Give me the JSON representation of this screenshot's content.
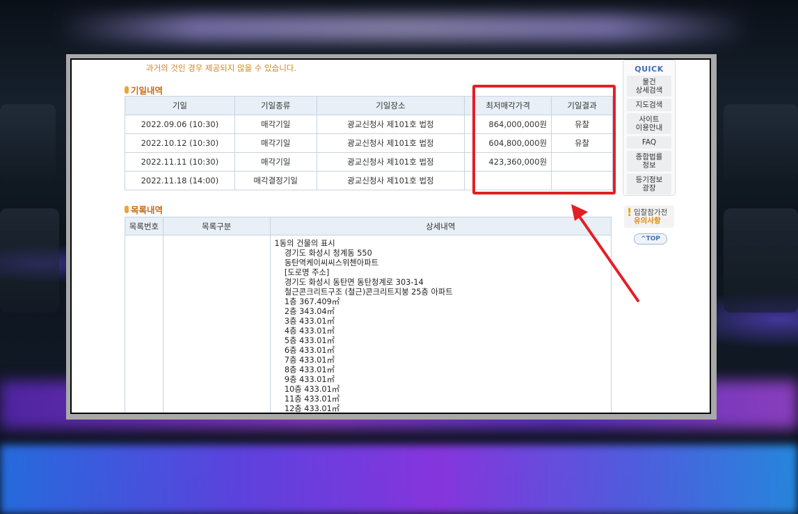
{
  "notice": "과거의 것인 경우 제공되지 않을 수 있습니다.",
  "auction_section": {
    "title": "기일내역",
    "headers": [
      "기일",
      "기일종류",
      "기일장소",
      "최저매각가격",
      "기일결과"
    ],
    "rows": [
      [
        "2022.09.06 (10:30)",
        "매각기일",
        "광교신청사 제101호 법정",
        "864,000,000원",
        "유찰"
      ],
      [
        "2022.10.12 (10:30)",
        "매각기일",
        "광교신청사 제101호 법정",
        "604,800,000원",
        "유찰"
      ],
      [
        "2022.11.11 (10:30)",
        "매각기일",
        "광교신청사 제101호 법정",
        "423,360,000원",
        ""
      ],
      [
        "2022.11.18 (14:00)",
        "매각결정기일",
        "광교신청사 제101호 법정",
        "",
        ""
      ]
    ]
  },
  "list_section": {
    "title": "목록내역",
    "headers": [
      "목록번호",
      "목록구분",
      "상세내역"
    ],
    "detail_lines": [
      "1동의 건물의 표시",
      "    경기도 화성시 청계동 550",
      "    동탄역케이씨씨스위첸아파트",
      "    [도로명 주소]",
      "    경기도 화성시 동탄면 동탄청계로 303-14",
      "    철근콘크리트구조 (철근)콘크리트지붕 25층 아파트",
      "    1층 367.409㎡",
      "    2층 343.04㎡",
      "    3층 433.01㎡",
      "    4층 433.01㎡",
      "    5층 433.01㎡",
      "    6층 433.01㎡",
      "    7층 433.01㎡",
      "    8층 433.01㎡",
      "    9층 433.01㎡",
      "    10층 433.01㎡",
      "    11층 433.01㎡",
      "    12층 433.01㎡"
    ]
  },
  "quick_menu": {
    "title": "QUICK",
    "items": [
      "물건\n상세검색",
      "지도검색",
      "사이트\n이용안내",
      "FAQ",
      "종합법률\n정보",
      "등기정보\n광장"
    ],
    "notice_line1": "입찰참가전",
    "notice_line2": "유의사항",
    "top_label": "^TOP"
  },
  "colors": {
    "highlight": "#e41e26",
    "section_title": "#c86a12",
    "header_bg": "#e8eff6"
  }
}
